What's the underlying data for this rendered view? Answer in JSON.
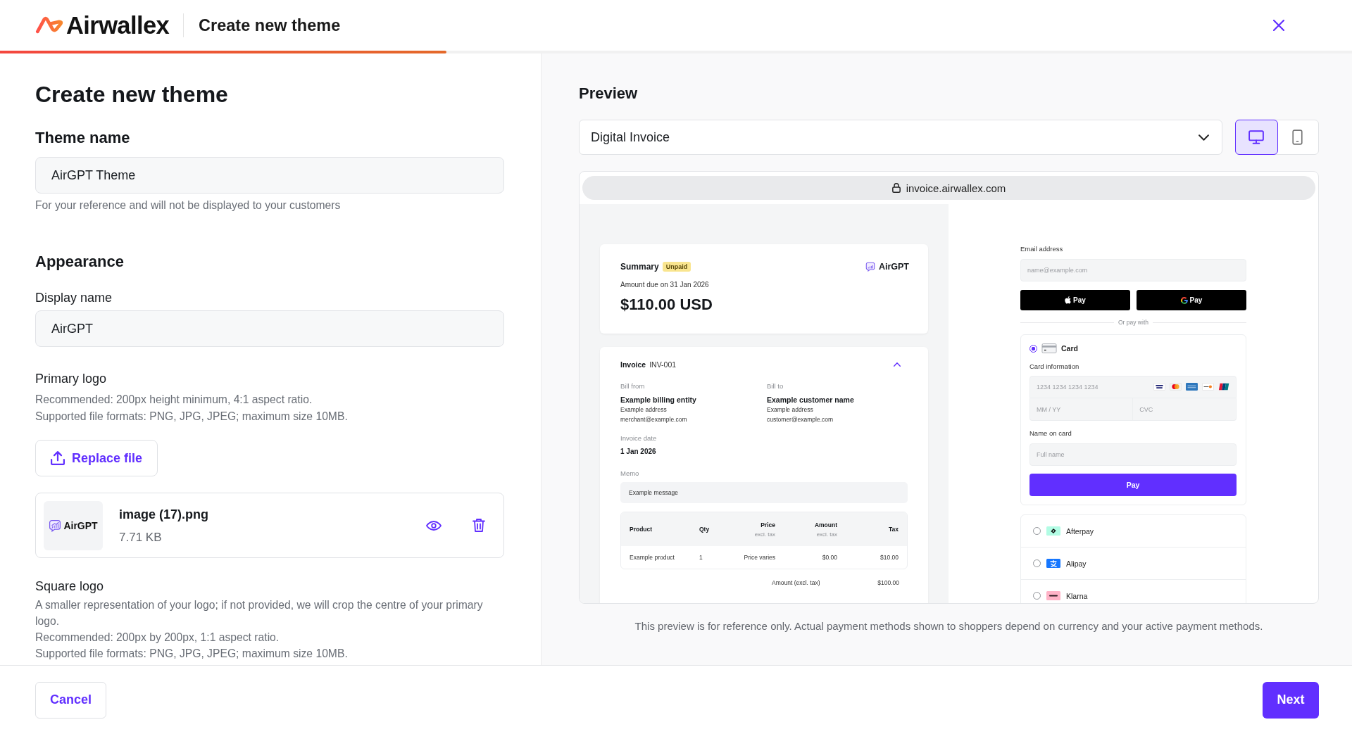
{
  "header": {
    "brand": "Airwallex",
    "title": "Create new theme",
    "progress": {
      "level": 0.33
    }
  },
  "form": {
    "title": "Create new theme",
    "theme_name": {
      "label": "Theme name",
      "value": "AirGPT Theme",
      "hint": "For your reference and will not be displayed to your customers"
    },
    "appearance": {
      "title": "Appearance",
      "display_name": {
        "label": "Display name",
        "value": "AirGPT"
      },
      "primary_logo": {
        "label": "Primary logo",
        "hints": [
          "Recommended: 200px height minimum, 4:1 aspect ratio.",
          "Supported file formats: PNG, JPG, JPEG; maximum size 10MB."
        ],
        "replace_button": "Replace file",
        "file": {
          "thumbnail_text": "AirGPT",
          "name": "image (17).png",
          "size": "7.71 KB"
        }
      },
      "square_logo": {
        "label": "Square logo",
        "hints": [
          "A smaller representation of your logo; if not provided, we will crop the centre of your primary logo.",
          "Recommended: 200px by 200px, 1:1 aspect ratio.",
          "Supported file formats: PNG, JPG, JPEG; maximum size 10MB."
        ]
      }
    }
  },
  "preview": {
    "title": "Preview",
    "template_select": {
      "value": "Digital Invoice"
    },
    "device_toggle": [
      {
        "kind": "desktop",
        "selected": true
      },
      {
        "kind": "mobile",
        "selected": false
      }
    ],
    "url": "invoice.airwallex.com",
    "invoice": {
      "summary": {
        "title": "Summary",
        "status": "Unpaid",
        "brand": "AirGPT",
        "due": "Amount due on 31 Jan 2026",
        "amount": "$110.00 USD"
      },
      "details": {
        "title": "Invoice",
        "number": "INV-001",
        "expanded": true,
        "parties": [
          {
            "label": "Bill from",
            "name": "Example billing entity",
            "address": "Example address",
            "email": "merchant@example.com"
          },
          {
            "label": "Bill to",
            "name": "Example customer name",
            "address": "Example address",
            "email": "customer@example.com"
          }
        ],
        "date_label": "Invoice date",
        "date": "1 Jan 2026",
        "memo_label": "Memo",
        "memo": "Example message",
        "table": {
          "columns": [
            {
              "label": "Product"
            },
            {
              "label": "Qty"
            },
            {
              "label": "Price",
              "note": "excl. tax"
            },
            {
              "label": "Amount",
              "note": "excl. tax"
            },
            {
              "label": "Tax"
            }
          ],
          "rows": [
            [
              "Example product",
              "1",
              "Price varies",
              "$0.00",
              "$10.00"
            ]
          ]
        },
        "totals": [
          {
            "label": "Amount (excl. tax)",
            "value": "$100.00"
          }
        ]
      }
    },
    "checkout": {
      "email": {
        "label": "Email address",
        "placeholder": "name@example.com"
      },
      "wallets": [
        {
          "kind": "apple",
          "label": "Pay"
        },
        {
          "kind": "google",
          "label": "Pay"
        }
      ],
      "divider": "Or pay with",
      "methods": [
        {
          "kind": "card",
          "label": "Card",
          "selected": true
        },
        {
          "kind": "afterpay",
          "label": "Afterpay",
          "selected": false
        },
        {
          "kind": "alipay",
          "label": "Alipay",
          "selected": false
        },
        {
          "kind": "klarna",
          "label": "Klarna",
          "selected": false
        }
      ],
      "card_form": {
        "label": "Card information",
        "number_placeholder": "1234 1234 1234 1234",
        "expiry_placeholder": "MM / YY",
        "cvc_placeholder": "CVC",
        "name_label": "Name on card",
        "name_placeholder": "Full name",
        "pay_button": "Pay"
      }
    },
    "note": "This preview is for reference only. Actual payment methods shown to shoppers depend on currency and your active payment methods."
  },
  "footer": {
    "cancel": "Cancel",
    "next": "Next"
  }
}
